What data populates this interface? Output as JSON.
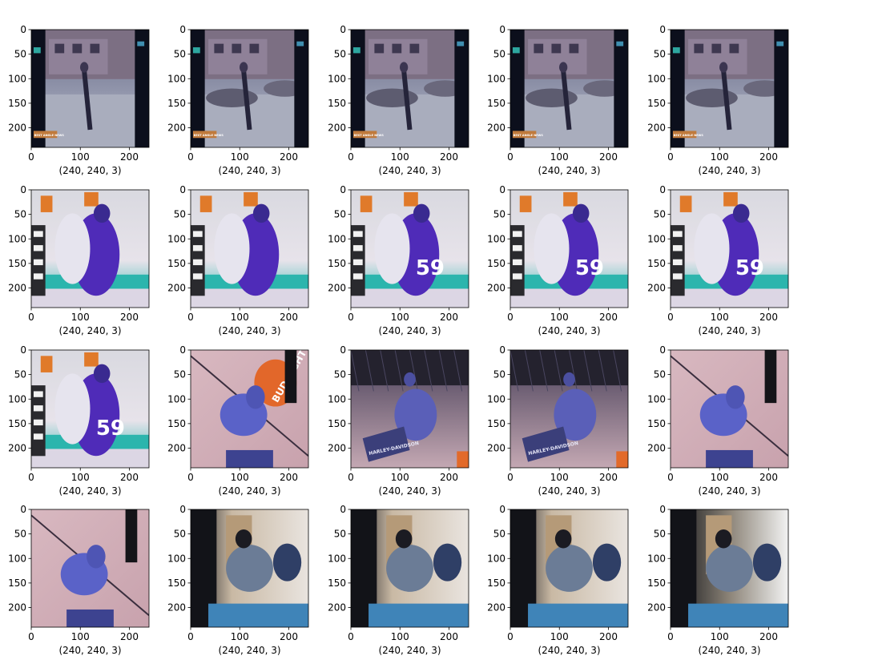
{
  "chart_data": {
    "type": "image_grid",
    "rows": 4,
    "cols": 5,
    "image_shape_label": "(240, 240, 3)",
    "xlim": [
      0,
      240
    ],
    "ylim": [
      240,
      0
    ],
    "x_ticks": [
      "0",
      "100",
      "200"
    ],
    "y_ticks": [
      "0",
      "50",
      "100",
      "150",
      "200"
    ],
    "grid": false,
    "panels": [
      {
        "scene": "street-fight-sidewalk",
        "caption": "(240, 240, 3)",
        "overlay_text": "BEST ANGLE NEWS"
      },
      {
        "scene": "street-fight-cars",
        "caption": "(240, 240, 3)",
        "overlay_text": "BEST ANGLE NEWS"
      },
      {
        "scene": "street-fight-buildings",
        "caption": "(240, 240, 3)",
        "overlay_text": "BEST ANGLE NEWS"
      },
      {
        "scene": "street-fight-parked-cars",
        "caption": "(240, 240, 3)",
        "overlay_text": "BEST ANGLE NEWS"
      },
      {
        "scene": "street-fight-running",
        "caption": "(240, 240, 3)",
        "overlay_text": "BEST ANGLE NEWS"
      },
      {
        "scene": "hockey-fight-boards",
        "caption": "(240, 240, 3)"
      },
      {
        "scene": "hockey-fight-referee",
        "caption": "(240, 240, 3)"
      },
      {
        "scene": "hockey-fight-number-59",
        "caption": "(240, 240, 3)",
        "overlay_text": "59"
      },
      {
        "scene": "hockey-fight-grapple",
        "caption": "(240, 240, 3)",
        "overlay_text": "59"
      },
      {
        "scene": "hockey-player-59-referee",
        "caption": "(240, 240, 3)",
        "overlay_text": "59"
      },
      {
        "scene": "hockey-player-59-closeup",
        "caption": "(240, 240, 3)",
        "overlay_text": "59"
      },
      {
        "scene": "mma-ground-bud-light",
        "caption": "(240, 240, 3)",
        "overlay_text": "BUD LIGHT"
      },
      {
        "scene": "mma-cage-harley",
        "caption": "(240, 240, 3)",
        "overlay_text": "HARLEY-DAVIDSON"
      },
      {
        "scene": "mma-cage-harley-2",
        "caption": "(240, 240, 3)",
        "overlay_text": "HARLEY-DAVIDSON"
      },
      {
        "scene": "mma-ground-referee",
        "caption": "(240, 240, 3)"
      },
      {
        "scene": "mma-ground-overhead",
        "caption": "(240, 240, 3)"
      },
      {
        "scene": "hallway-fight-doorway",
        "caption": "(240, 240, 3)"
      },
      {
        "scene": "hallway-fight-crowd",
        "caption": "(240, 240, 3)"
      },
      {
        "scene": "hallway-fight-kick",
        "caption": "(240, 240, 3)"
      },
      {
        "scene": "hallway-fight-blur",
        "caption": "(240, 240, 3)"
      }
    ]
  }
}
